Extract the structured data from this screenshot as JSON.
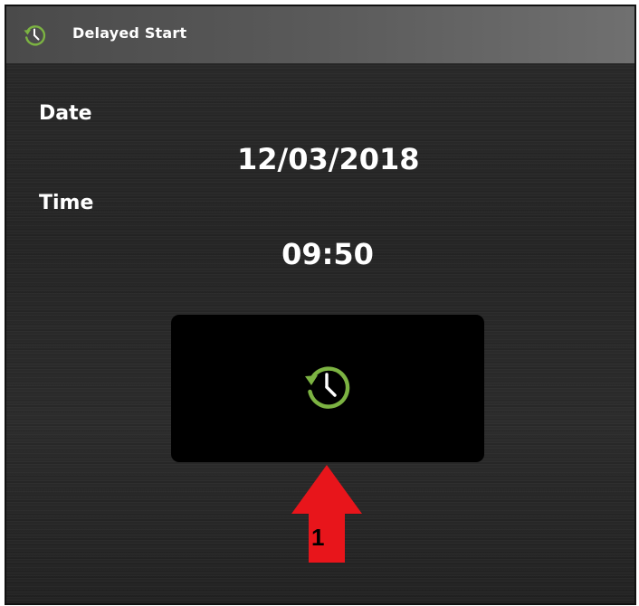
{
  "titlebar": {
    "icon": "clock-history-icon",
    "title": "Delayed Start"
  },
  "form": {
    "date_label": "Date",
    "date_value": "12/03/2018",
    "time_label": "Time",
    "time_value": "09:50"
  },
  "start_button": {
    "icon": "clock-history-icon"
  },
  "annotation": {
    "arrow_color": "#e8151b",
    "number": "1"
  },
  "colors": {
    "accent": "#7cb342",
    "background": "#272727",
    "titlebar": "#5a5a5a"
  }
}
